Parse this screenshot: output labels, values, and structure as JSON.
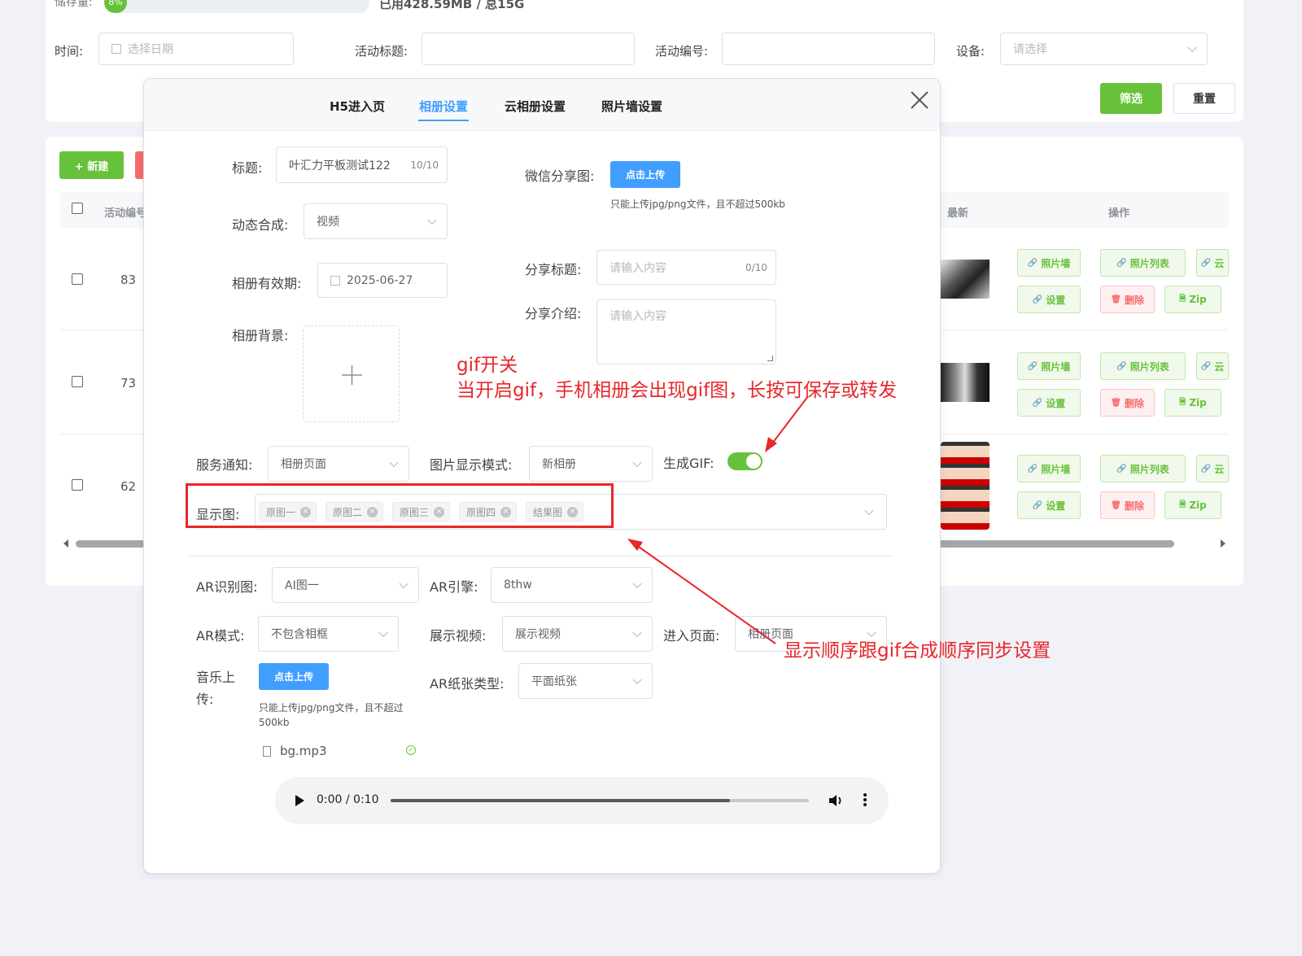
{
  "top": {
    "storage_label": "储存量:",
    "storage_percent": "8%",
    "storage_fraction": 0.08,
    "storage_text": "已用428.59MB / 总15G"
  },
  "filters": {
    "time_label": "时间:",
    "date_placeholder": "选择日期",
    "title_label": "活动标题:",
    "id_label": "活动编号:",
    "device_label": "设备:",
    "device_placeholder": "请选择",
    "filter_btn": "筛选",
    "reset_btn": "重置"
  },
  "list": {
    "new_btn": "+ 新建",
    "col_id": "活动编号",
    "col_latest": "最新",
    "col_ops": "操作",
    "rows": [
      {
        "id": "83"
      },
      {
        "id": "73"
      },
      {
        "id": "62"
      }
    ],
    "ops": {
      "wall": "照片墙",
      "list": "照片列表",
      "cloud": "云",
      "settings": "设置",
      "delete": "删除",
      "zip": "Zip"
    }
  },
  "modal": {
    "tabs": [
      "H5进入页",
      "相册设置",
      "云相册设置",
      "照片墙设置"
    ],
    "active_tab": 1,
    "title_label": "标题:",
    "title_value": "叶汇力平板测试122",
    "title_count": "10/10",
    "dynamic_label": "动态合成:",
    "dynamic_value": "视频",
    "expiry_label": "相册有效期:",
    "expiry_value": "2025-06-27",
    "bg_label": "相册背景:",
    "wechat_label": "微信分享图:",
    "upload_btn": "点击上传",
    "upload_hint": "只能上传jpg/png文件，且不超过500kb",
    "share_title_label": "分享标题:",
    "share_title_placeholder": "请输入内容",
    "share_title_count": "0/10",
    "share_desc_label": "分享介绍:",
    "share_desc_placeholder": "请输入内容",
    "notify_label": "服务通知:",
    "notify_value": "相册页面",
    "display_mode_label": "图片显示模式:",
    "display_mode_value": "新相册",
    "gif_label": "生成GIF:",
    "gif_on": true,
    "show_label": "显示图:",
    "show_tags": [
      "原图一",
      "原图二",
      "原图三",
      "原图四",
      "结果图"
    ],
    "ar_img_label": "AR识别图:",
    "ar_img_value": "AI图一",
    "ar_engine_label": "AR引擎:",
    "ar_engine_value": "8thw",
    "ar_mode_label": "AR模式:",
    "ar_mode_value": "不包含相框",
    "video_label": "展示视频:",
    "video_value": "展示视频",
    "enter_label": "进入页面:",
    "enter_value": "相册页面",
    "music_label_1": "音乐上",
    "music_label_2": "传:",
    "music_upload_btn": "点击上传",
    "music_hint_1": "只能上传jpg/png文件，且不超过",
    "music_hint_2": "500kb",
    "file_name": "bg.mp3",
    "paper_label": "AR纸张类型:",
    "paper_value": "平面纸张",
    "audio_time": "0:00 / 0:10",
    "audio_progress": 0.0
  },
  "annotations": {
    "gif_title": "gif开关",
    "gif_desc": "当开启gif，手机相册会出现gif图，长按可保存或转发",
    "order_desc": "显示顺序跟gif合成顺序同步设置"
  },
  "colors": {
    "primary": "#409eff",
    "success": "#67c23a",
    "danger": "#f56c6c",
    "annotation": "#e8262b"
  }
}
